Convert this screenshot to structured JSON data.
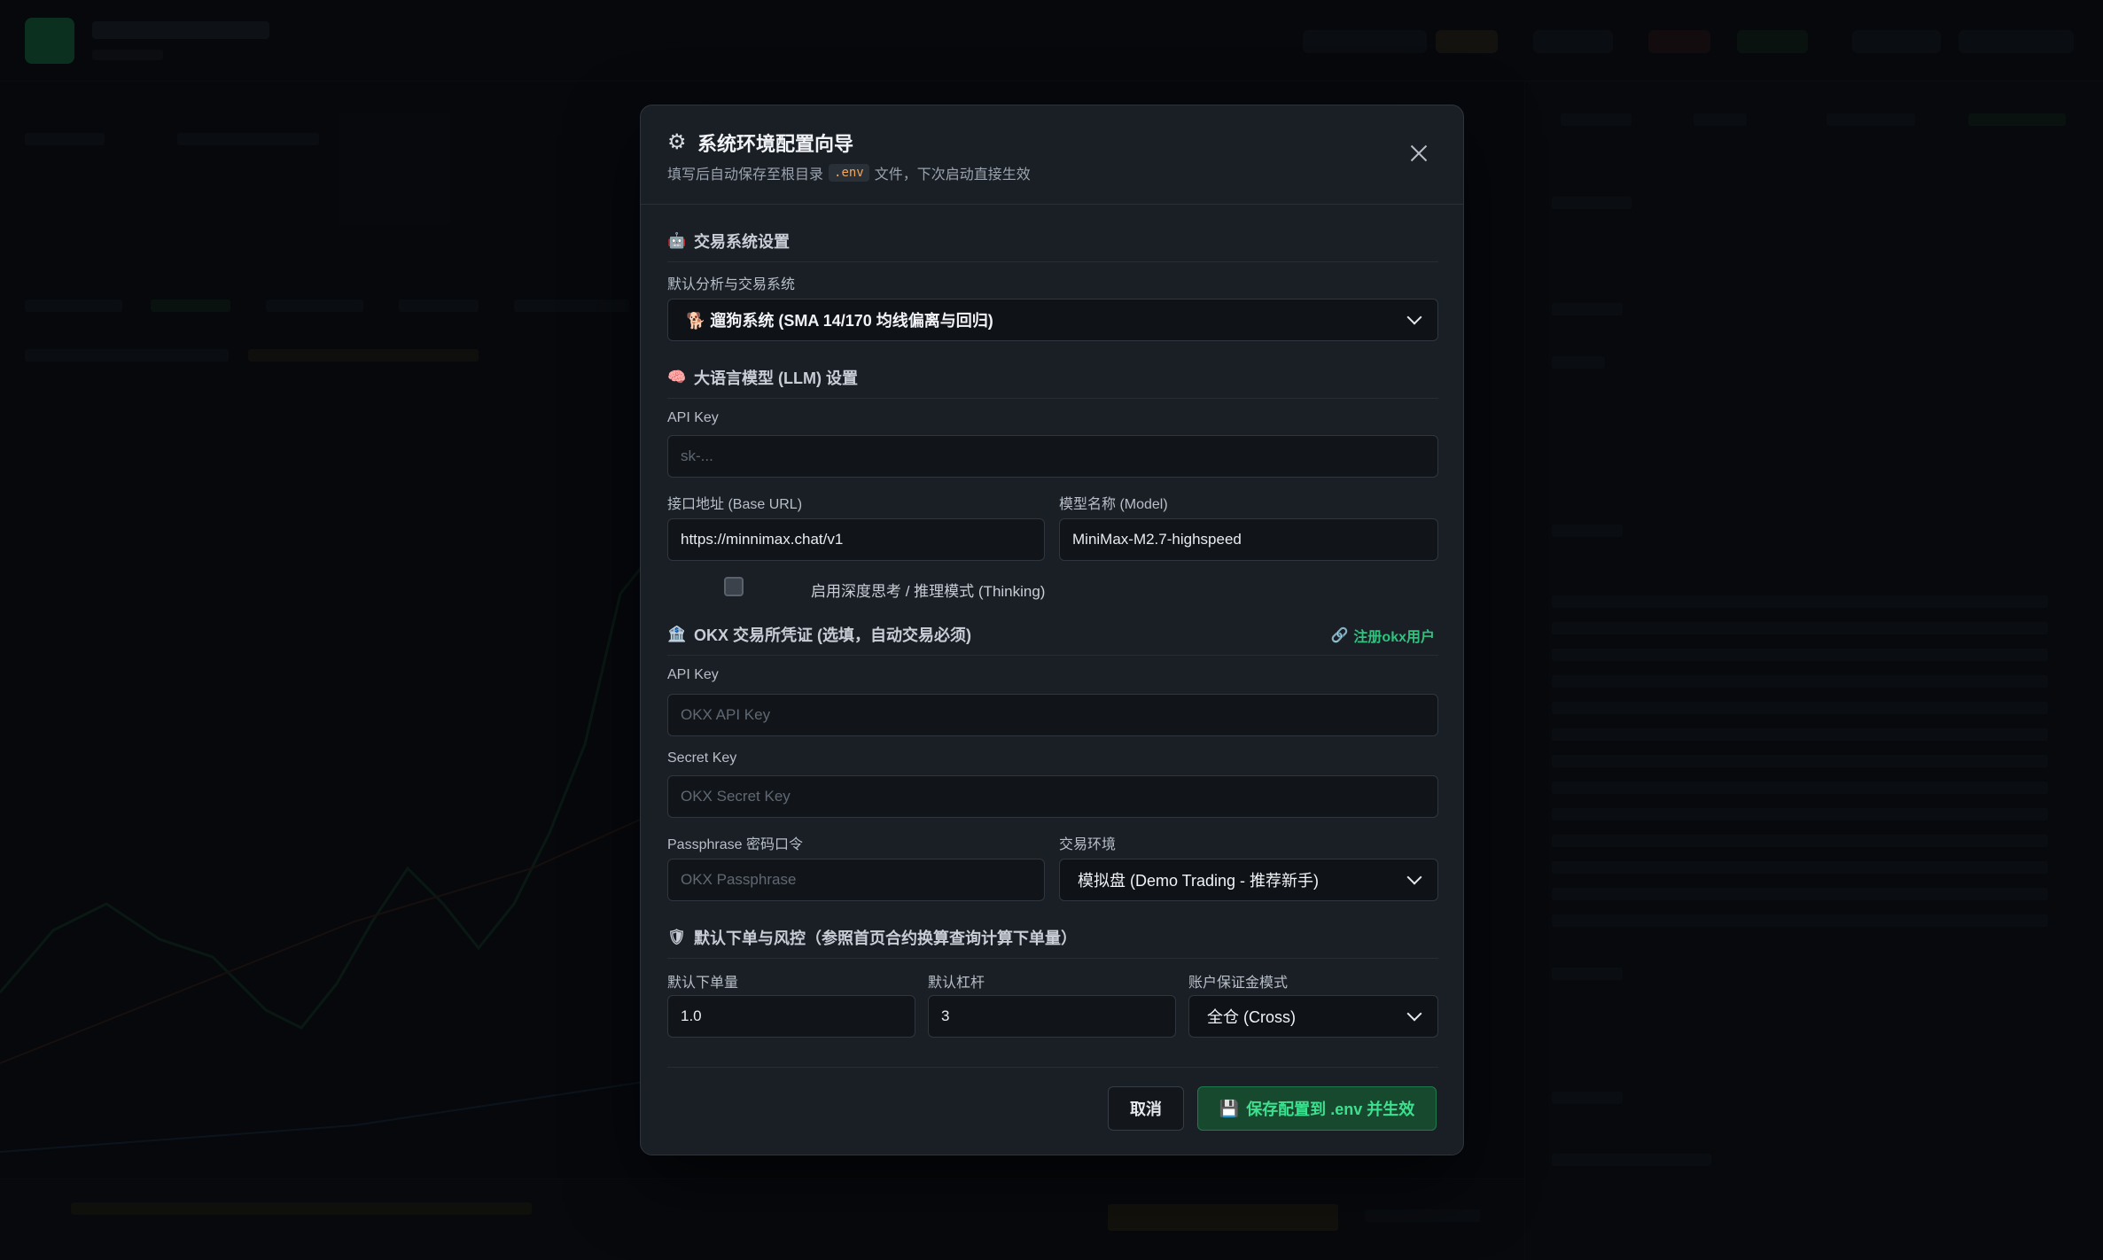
{
  "modal": {
    "title": "系统环境配置向导",
    "subtitle_before": "填写后自动保存至根目录",
    "subtitle_code": ".env",
    "subtitle_after": "文件，下次启动直接生效"
  },
  "trading_system": {
    "section_title": "交易系统设置",
    "label": "默认分析与交易系统",
    "selected": "🐕 遛狗系统 (SMA 14/170 均线偏离与回归)"
  },
  "llm": {
    "section_title": "大语言模型 (LLM) 设置",
    "api_key_label": "API Key",
    "api_key_placeholder": "sk-...",
    "base_url_label": "接口地址 (Base URL)",
    "base_url_value": "https://minnimax.chat/v1",
    "model_label": "模型名称 (Model)",
    "model_value": "MiniMax-M2.7-highspeed",
    "thinking_label": "启用深度思考 / 推理模式 (Thinking)"
  },
  "okx": {
    "section_title": "OKX 交易所凭证 (选填，自动交易必须)",
    "register_link": "注册okx用户",
    "api_key_label": "API Key",
    "api_key_placeholder": "OKX API Key",
    "secret_label": "Secret Key",
    "secret_placeholder": "OKX Secret Key",
    "passphrase_label": "Passphrase 密码口令",
    "passphrase_placeholder": "OKX Passphrase",
    "env_label": "交易环境",
    "env_selected": "模拟盘 (Demo Trading - 推荐新手)"
  },
  "risk": {
    "section_title": "默认下单与风控（参照首页合约换算查询计算下单量）",
    "size_label": "默认下单量",
    "size_value": "1.0",
    "leverage_label": "默认杠杆",
    "leverage_value": "3",
    "margin_label": "账户保证金模式",
    "margin_selected": "全仓 (Cross)"
  },
  "footer": {
    "cancel": "取消",
    "save": "保存配置到 .env 并生效"
  },
  "colors": {
    "accent_green": "#2ec27e",
    "code_orange": "#f2a65a",
    "modal_bg": "#1a1f26"
  }
}
